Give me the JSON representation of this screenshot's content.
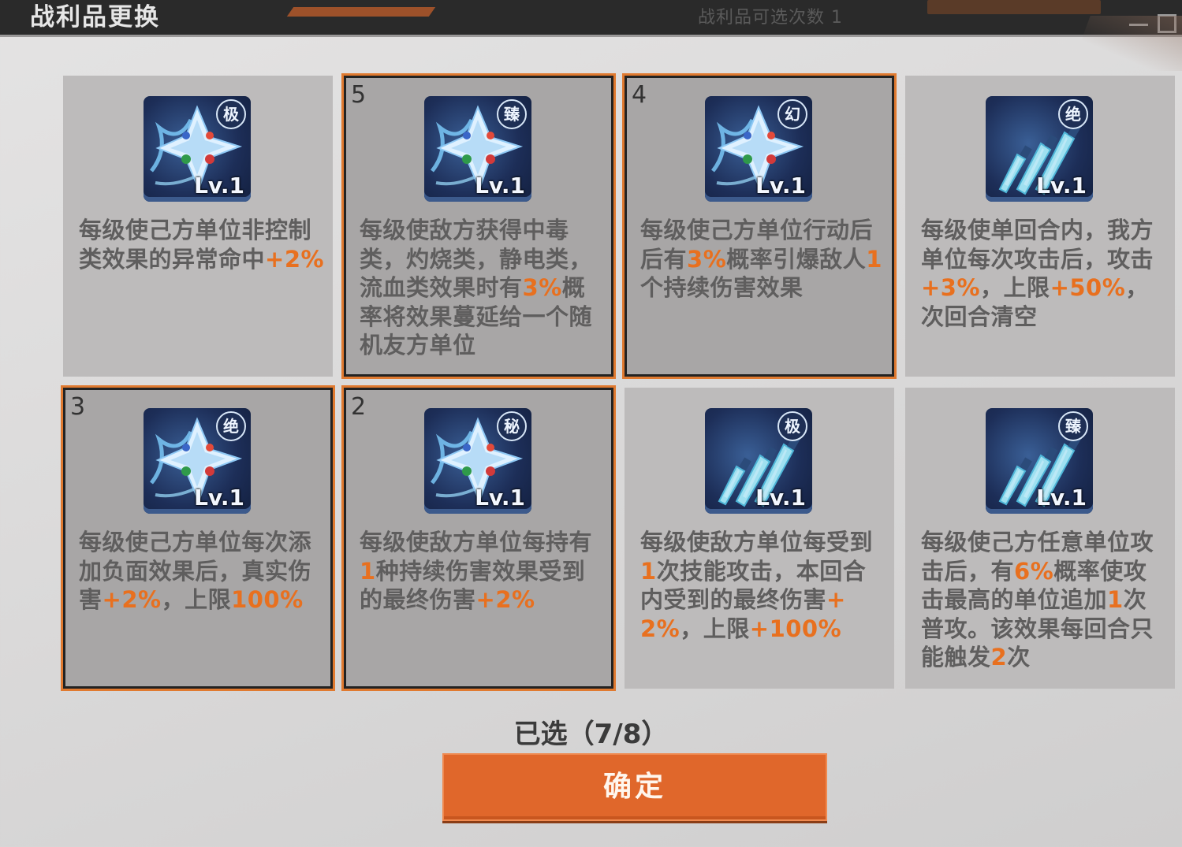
{
  "header": {
    "title": "战利品更换",
    "hint": "战利品可选次数 1"
  },
  "cards": [
    {
      "badge": "极",
      "level": "Lv.1",
      "icon": "star-emblem-icon",
      "selected": false,
      "order": "",
      "desc": [
        {
          "t": "每级使己方单位非控制类效果的异常命中"
        },
        {
          "t": "+2%",
          "h": true
        }
      ]
    },
    {
      "badge": "臻",
      "level": "Lv.1",
      "icon": "star-emblem-icon",
      "selected": true,
      "order": "5",
      "desc": [
        {
          "t": "每级使敌方获得中毒类，灼烧类，静电类，流血类效果时有"
        },
        {
          "t": "3%",
          "h": true
        },
        {
          "t": "概率将效果蔓延给一个随机友方单位"
        }
      ]
    },
    {
      "badge": "幻",
      "level": "Lv.1",
      "icon": "star-emblem-icon",
      "selected": true,
      "order": "4",
      "desc": [
        {
          "t": "每级使己方单位行动后后有"
        },
        {
          "t": "3%",
          "h": true
        },
        {
          "t": "概率引爆敌人"
        },
        {
          "t": "1",
          "h": true
        },
        {
          "t": "个持续伤害效果"
        }
      ]
    },
    {
      "badge": "绝",
      "level": "Lv.1",
      "icon": "triple-blade-icon",
      "selected": false,
      "order": "",
      "desc": [
        {
          "t": "每级使单回合内，我方单位每次攻击后，攻击"
        },
        {
          "t": "+3%",
          "h": true
        },
        {
          "t": "，上限"
        },
        {
          "t": "+50%",
          "h": true
        },
        {
          "t": "，次回合清空"
        }
      ]
    },
    {
      "badge": "绝",
      "level": "Lv.1",
      "icon": "star-emblem-icon",
      "selected": true,
      "order": "3",
      "desc": [
        {
          "t": "每级使己方单位每次添加负面效果后，真实伤害"
        },
        {
          "t": "+2%",
          "h": true
        },
        {
          "t": "，上限"
        },
        {
          "t": "100%",
          "h": true
        }
      ]
    },
    {
      "badge": "秘",
      "level": "Lv.1",
      "icon": "star-emblem-icon",
      "selected": true,
      "order": "2",
      "desc": [
        {
          "t": "每级使敌方单位每持有"
        },
        {
          "t": "1",
          "h": true
        },
        {
          "t": "种持续伤害效果受到的最终伤害"
        },
        {
          "t": "+2%",
          "h": true
        }
      ]
    },
    {
      "badge": "极",
      "level": "Lv.1",
      "icon": "triple-blade-icon",
      "selected": false,
      "order": "",
      "desc": [
        {
          "t": "每级使敌方单位每受到"
        },
        {
          "t": "1",
          "h": true
        },
        {
          "t": "次技能攻击，本回合内受到的最终伤害"
        },
        {
          "t": "+2%",
          "h": true
        },
        {
          "t": "，上限"
        },
        {
          "t": "+100%",
          "h": true
        }
      ]
    },
    {
      "badge": "臻",
      "level": "Lv.1",
      "icon": "triple-blade-icon",
      "selected": false,
      "order": "",
      "desc": [
        {
          "t": "每级使己方任意单位攻击后，有"
        },
        {
          "t": "6%",
          "h": true
        },
        {
          "t": "概率使攻击最高的单位追加"
        },
        {
          "t": "1",
          "h": true
        },
        {
          "t": "次普攻。该效果每回合只能触发"
        },
        {
          "t": "2",
          "h": true
        },
        {
          "t": "次"
        }
      ]
    }
  ],
  "footer": {
    "selected_count": "已选（7/8）",
    "confirm_label": "确定"
  },
  "colors": {
    "highlight": "#e8701f",
    "accent": "#e0672b"
  }
}
